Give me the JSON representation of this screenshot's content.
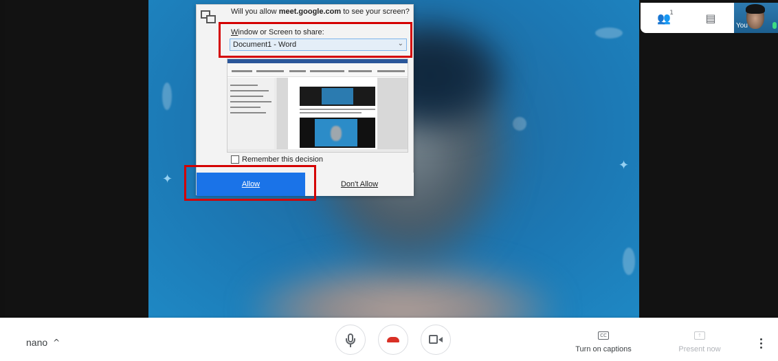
{
  "meeting": {
    "name": "nano"
  },
  "top_panel": {
    "participants_count": "1",
    "self_label": "You"
  },
  "dialog": {
    "question_prefix": "Will you allow ",
    "question_domain": "meet.google.com",
    "question_suffix": " to see your screen?",
    "share_label_access": "W",
    "share_label_rest": "indow or Screen to share:",
    "selected_window": "Document1 - Word",
    "remember_label": "Remember this decision",
    "allow_label": "Allow",
    "deny_label": "Don't Allow"
  },
  "controls": {
    "captions_icon": "CC",
    "captions_label": "Turn on captions",
    "present_label": "Present now"
  },
  "colors": {
    "accent": "#1a73e8",
    "end_call": "#d93025",
    "highlight": "#d40000"
  },
  "icons": [
    "people-icon",
    "chat-icon",
    "mic-icon",
    "end-call-icon",
    "camera-icon",
    "captions-icon",
    "present-icon",
    "more-vert-icon",
    "caret-up-icon",
    "screen-share-icon",
    "dropdown-chevron-icon"
  ]
}
